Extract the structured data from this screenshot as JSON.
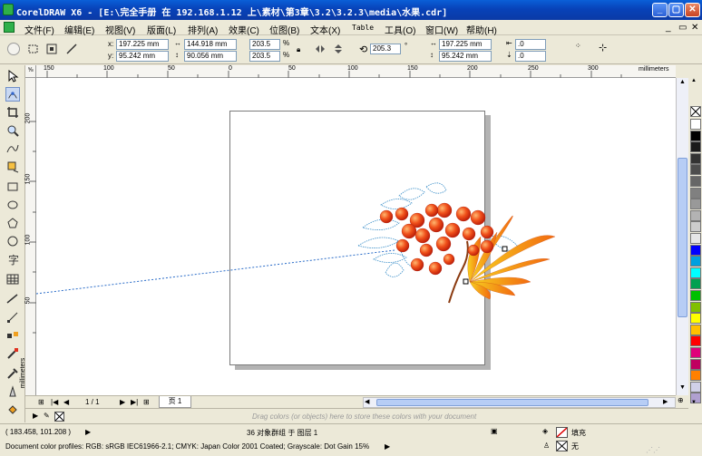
{
  "window": {
    "title": "CorelDRAW X6 - [E:\\完全手册 在 192.168.1.12 上\\素材\\第3章\\3.2\\3.2.3\\media\\水果.cdr]"
  },
  "menu": [
    "文件(F)",
    "编辑(E)",
    "视图(V)",
    "版面(L)",
    "排列(A)",
    "效果(C)",
    "位图(B)",
    "文本(X)",
    "Table",
    "工具(O)",
    "窗口(W)",
    "帮助(H)"
  ],
  "propbar": {
    "x_label": "x:",
    "x_value": "197.225 mm",
    "y_label": "y:",
    "y_value": "95.242 mm",
    "w_value": "144.918 mm",
    "h_value": "90.056 mm",
    "sx_value": "203.5",
    "sy_value": "203.5",
    "pct": "%",
    "angle_value": "205.3",
    "deg": "°",
    "cx_value": "197.225 mm",
    "cy_value": "95.242 mm",
    "ox_value": ".0",
    "oy_value": ".0"
  },
  "hruler": {
    "unit": "millimeters",
    "ticks": [
      "150",
      "100",
      "50",
      "0",
      "50",
      "100",
      "150",
      "200",
      "250",
      "300"
    ]
  },
  "vruler": {
    "unit": "millimeters",
    "ticks": [
      "200",
      "150",
      "100",
      "50"
    ]
  },
  "pagebar": {
    "page_count": "1 / 1",
    "page_tab": "页 1"
  },
  "colorbar": {
    "hint": "Drag colors (or objects) here to store these colors with your document"
  },
  "status": {
    "coords": "( 183.458, 101.208 )",
    "selection": "36 对象群组 于 图层 1",
    "profile": "Document color profiles: RGB: sRGB IEC61966-2.1; CMYK: Japan Color 2001 Coated; Grayscale: Dot Gain 15%",
    "fill_label": "填充",
    "outline_label": "无"
  },
  "palette_colors": [
    "#ffffff",
    "#000000",
    "#1a1a1a",
    "#333333",
    "#4d4d4d",
    "#666666",
    "#808080",
    "#999999",
    "#b3b3b3",
    "#cccccc",
    "#e6e6e6",
    "#0000ff",
    "#00a0e0",
    "#00ffff",
    "#00a050",
    "#00c000",
    "#80c000",
    "#ffff00",
    "#ffc000",
    "#ff0000",
    "#e0007a",
    "#c00060",
    "#ff8000",
    "#d0d0e8",
    "#b0a0d0"
  ]
}
